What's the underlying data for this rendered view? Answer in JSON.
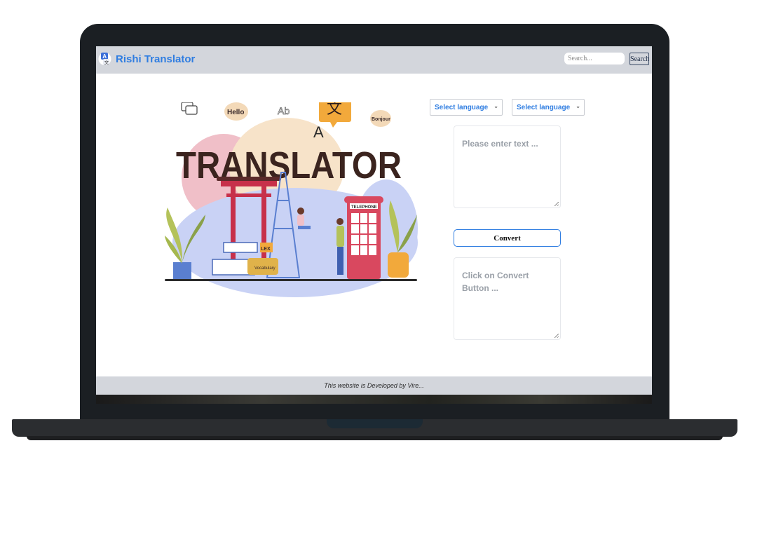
{
  "navbar": {
    "brand": "Rishi Translator",
    "search_placeholder": "Search...",
    "search_button": "Search"
  },
  "illustration": {
    "words": [
      "Hello",
      "Ab",
      "文",
      "Bonjour",
      "A",
      "TRANSLATOR",
      "TELEPHONE",
      "LEX",
      "Vocabulary"
    ]
  },
  "translator": {
    "from_language": "Select language",
    "to_language": "Select language",
    "input_placeholder": "Please enter text ...",
    "convert_label": "Convert",
    "output_placeholder": "Click on Convert Button ..."
  },
  "footer": {
    "text": "This website is Developed by Vire..."
  },
  "colors": {
    "brand": "#2f7de1",
    "navbar_bg": "#d3d6dc",
    "bezel": "#1b1f23"
  }
}
